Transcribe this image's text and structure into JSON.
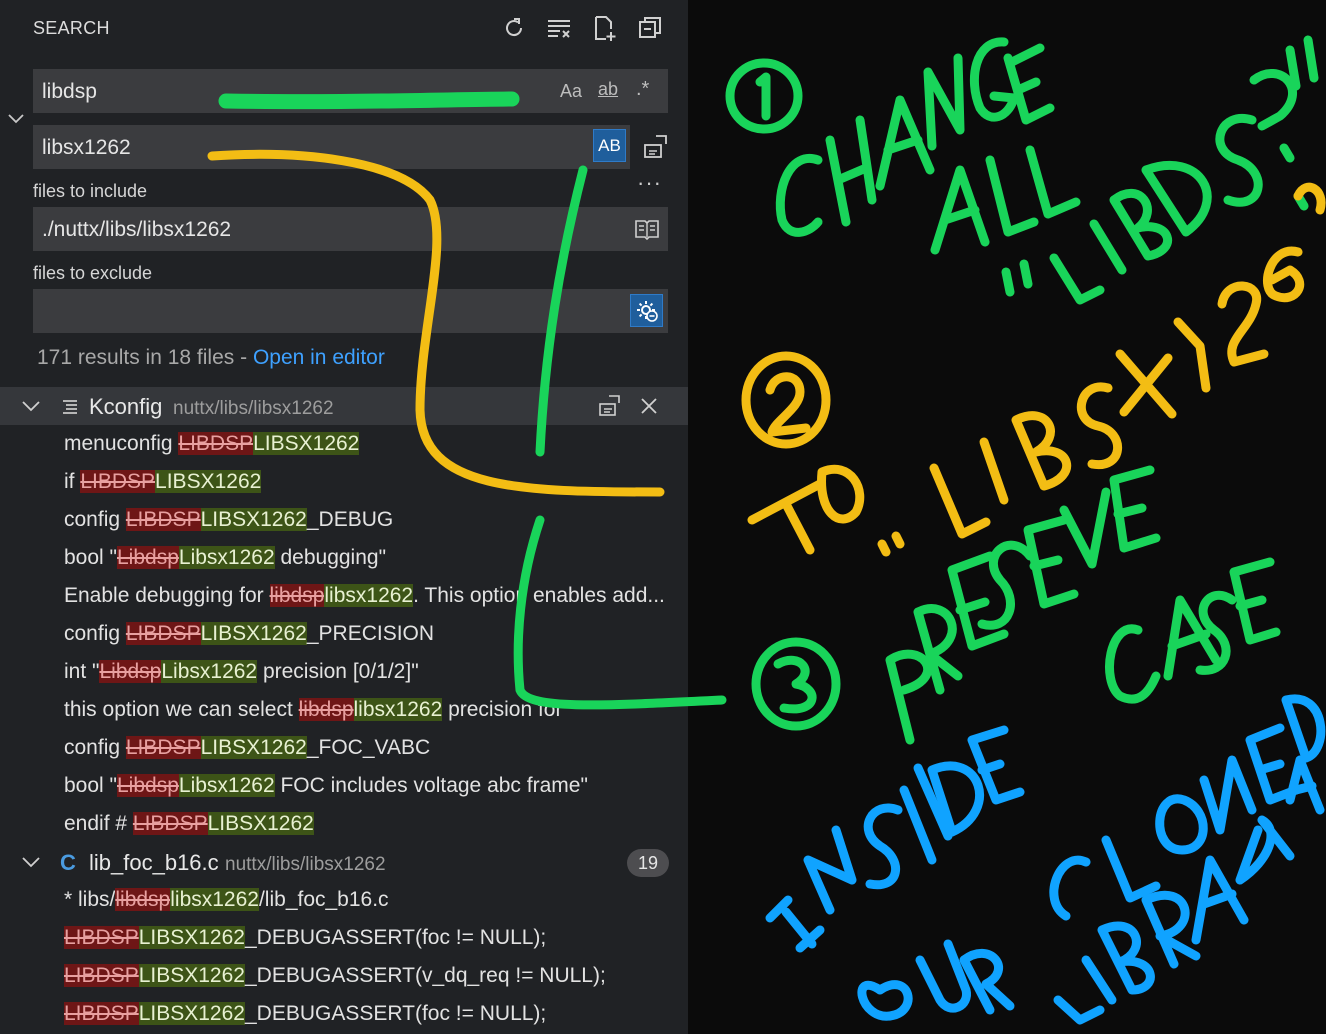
{
  "panel": {
    "title": "SEARCH",
    "search": {
      "value": "libdsp",
      "opt_case": "Aa",
      "opt_word": "ab",
      "opt_regex": ".*"
    },
    "replace": {
      "value": "libsx1262",
      "preserve_case_label": "AB"
    },
    "more_label": "···",
    "include": {
      "label": "files to include",
      "value": "./nuttx/libs/libsx1262"
    },
    "exclude": {
      "label": "files to exclude",
      "value": ""
    },
    "summary": {
      "text": "171 results in 18 files - ",
      "link": "Open in editor"
    }
  },
  "files": [
    {
      "name": "Kconfig",
      "path": "nuttx/libs/libsx1262",
      "matches": [
        {
          "pre": "menuconfig ",
          "del": "LIBDSP",
          "ins": "LIBSX1262",
          "post": ""
        },
        {
          "pre": "if ",
          "del": "LIBDSP",
          "ins": "LIBSX1262",
          "post": ""
        },
        {
          "pre": "config ",
          "del": "LIBDSP",
          "ins": "LIBSX1262",
          "post": "_DEBUG"
        },
        {
          "pre": "bool \"",
          "del": "Libdsp",
          "ins": "Libsx1262",
          "post": " debugging\""
        },
        {
          "pre": "Enable debugging for ",
          "del": "libdsp",
          "ins": "libsx1262",
          "post": ". This option enables add..."
        },
        {
          "pre": "config ",
          "del": "LIBDSP",
          "ins": "LIBSX1262",
          "post": "_PRECISION"
        },
        {
          "pre": "int \"",
          "del": "Libdsp",
          "ins": "Libsx1262",
          "post": " precision [0/1/2]\""
        },
        {
          "pre": "this option we can select ",
          "del": "libdsp",
          "ins": "libsx1262",
          "post": " precision for"
        },
        {
          "pre": "config ",
          "del": "LIBDSP",
          "ins": "LIBSX1262",
          "post": "_FOC_VABC"
        },
        {
          "pre": "bool \"",
          "del": "Libdsp",
          "ins": "Libsx1262",
          "post": " FOC includes voltage abc frame\""
        },
        {
          "pre": "endif # ",
          "del": "LIBDSP",
          "ins": "LIBSX1262",
          "post": ""
        }
      ]
    },
    {
      "name": "lib_foc_b16.c",
      "path": "nuttx/libs/libsx1262",
      "count": "19",
      "icon_letter": "C",
      "matches": [
        {
          "pre": "* libs/",
          "del": "libdsp",
          "ins": "libsx1262",
          "post": "/lib_foc_b16.c"
        },
        {
          "pre": "",
          "del": "LIBDSP",
          "ins": "LIBSX1262",
          "post": "_DEBUGASSERT(foc != NULL);"
        },
        {
          "pre": "",
          "del": "LIBDSP",
          "ins": "LIBSX1262",
          "post": "_DEBUGASSERT(v_dq_req != NULL);"
        },
        {
          "pre": "",
          "del": "LIBDSP",
          "ins": "LIBSX1262",
          "post": "_DEBUGASSERT(foc != NULL);"
        }
      ]
    }
  ],
  "colors": {
    "annotation_green": "#19d45a",
    "annotation_yellow": "#f3bd14",
    "annotation_blue": "#10a3ff",
    "link": "#3ea1ff",
    "preserve_case_button": "#1f5e9c"
  }
}
